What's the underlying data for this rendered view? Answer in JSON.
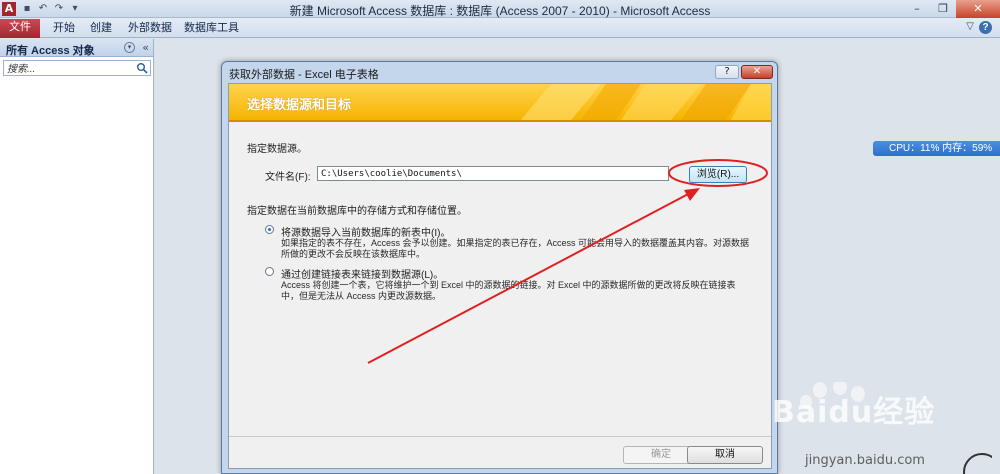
{
  "window": {
    "title": "新建 Microsoft Access 数据库 : 数据库 (Access 2007 - 2010) - Microsoft Access",
    "logo_letter": "A",
    "qat_icons": [
      "save-icon",
      "undo-icon",
      "redo-icon",
      "customize-icon"
    ],
    "controls": {
      "minimize": "–",
      "restore": "❐",
      "close": "✕"
    }
  },
  "ribbon": {
    "tabs": [
      {
        "label": "文件",
        "active": true
      },
      {
        "label": "开始"
      },
      {
        "label": "创建"
      },
      {
        "label": "外部数据"
      },
      {
        "label": "数据库工具"
      }
    ],
    "help": "?",
    "minimize_ribbon": "▽"
  },
  "nav_pane": {
    "title": "所有 Access 对象",
    "dropdown_glyph": "▾",
    "collapse_glyph": "«",
    "search_placeholder": "搜索..."
  },
  "cpu_widget": {
    "text": "CPU：11%  内存：59%"
  },
  "dialog": {
    "title": "获取外部数据 - Excel 电子表格",
    "help_glyph": "?",
    "close_glyph": "✕",
    "banner": "选择数据源和目标",
    "source_heading": "指定数据源。",
    "file_label": "文件名(F):",
    "file_value": "C:\\Users\\coolie\\Documents\\",
    "browse_button": "浏览(R)...",
    "storage_heading": "指定数据在当前数据库中的存储方式和存储位置。",
    "options": [
      {
        "label": "将源数据导入当前数据库的新表中(I)。",
        "checked": true,
        "description": "如果指定的表不存在，Access 会予以创建。如果指定的表已存在，Access 可能会用导入的数据覆盖其内容。对源数据所做的更改不会反映在该数据库中。"
      },
      {
        "label": "通过创建链接表来链接到数据源(L)。",
        "checked": false,
        "description": "Access 将创建一个表，它将维护一个到 Excel 中的源数据的链接。对 Excel 中的源数据所做的更改将反映在链接表中，但是无法从 Access 内更改源数据。"
      }
    ],
    "ok_button": "确定",
    "cancel_button": "取消"
  },
  "watermark": {
    "brand": "Baidu经验",
    "url": "jingyan.baidu.com"
  },
  "colors": {
    "file_tab": "#a4262c",
    "banner": "#f6b400",
    "annotation_red": "#e02020",
    "cpu_widget": "#2f6fcb"
  }
}
